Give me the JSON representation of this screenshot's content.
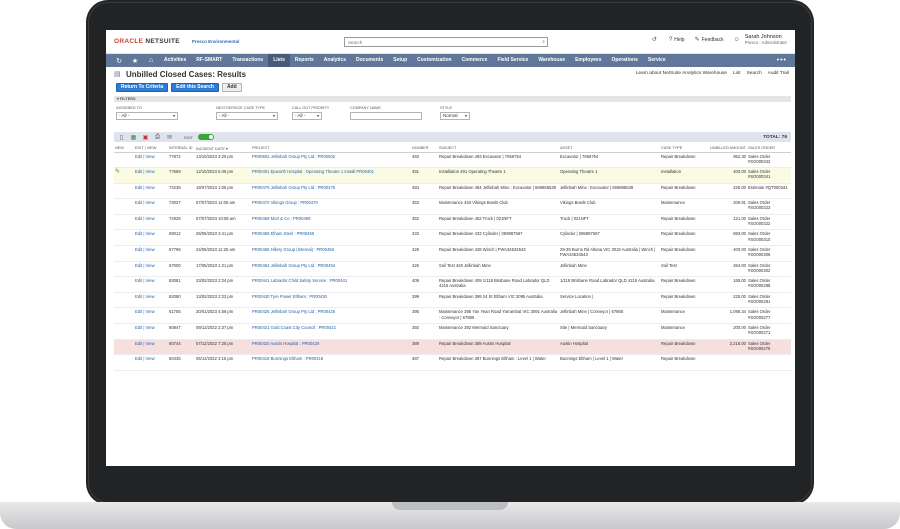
{
  "brand": {
    "oracle": "ORACLE",
    "netsuite": "NETSUITE",
    "partner": "Presco Environmental"
  },
  "search": {
    "placeholder": "Search"
  },
  "header": {
    "help": "Help",
    "feedback": "Feedback",
    "user_name": "Sarah Johnson",
    "user_role": "Presco - Administrator"
  },
  "nav": {
    "items": [
      "Activities",
      "RF-SMART",
      "Transactions",
      "Lists",
      "Reports",
      "Analytics",
      "Documents",
      "Setup",
      "Customization",
      "Commerce",
      "Field Service",
      "Warehouse",
      "Employees",
      "Operations",
      "Service"
    ],
    "active": "Lists",
    "more": "•••"
  },
  "page": {
    "title": "Unbilled Closed Cases: Results",
    "links": [
      "Learn about NetSuite Analytics Warehouse",
      "List",
      "Search",
      "Audit Trail"
    ]
  },
  "buttons": {
    "return": "Return To Criteria",
    "edit_search": "Edit this Search",
    "add": "Add"
  },
  "filters": {
    "bar_label": "FILTERS",
    "assigned_to": {
      "label": "ASSIGNED TO",
      "value": "- All -"
    },
    "case_type": {
      "label": "NEXTSERVICE CASE TYPE",
      "value": "- All -"
    },
    "priority": {
      "label": "CALL OUT PRIORITY",
      "value": "- All -"
    },
    "company": {
      "label": "COMPANY NAME",
      "value": ""
    },
    "style": {
      "label": "STYLE",
      "value": "Normal"
    }
  },
  "toolbar": {
    "edit_label": "EDIT",
    "total": "TOTAL: 76"
  },
  "columns": [
    "NEW",
    "EDIT | VIEW",
    "INTERNAL ID",
    "INCIDENT DATE ▾",
    "PROJECT",
    "NUMBER",
    "SUBJECT",
    "ASSET",
    "CASE TYPE",
    "UNBILLED AMOUNT",
    "SALES ORDER"
  ],
  "rows": [
    {
      "ev": "Edit | View",
      "id": "77872",
      "date": "13/10/2023 3:29 pm",
      "project": "PR00502 Jellinbah Group Pty Ltd : PR00502",
      "number": "493",
      "subject": "Repair Breakdown 493 Excavator | 7656754",
      "asset": "Excavator | 7656754",
      "type": "Repair Breakdown",
      "amount": "952.30",
      "so": "Sales Order #SO000342",
      "hl": ""
    },
    {
      "ev": "Edit | View",
      "id": "77569",
      "date": "12/10/2023 5:49 pm",
      "project": "PR00401 Epworth Hospital : Operating Theatre 1 Install PR00401",
      "number": "491",
      "subject": "Installation 491 Operating Theatre 1",
      "asset": "Operating Theatre 1",
      "type": "Installation",
      "amount": "400.00",
      "so": "Sales Order #SO000341",
      "hl": "yellow"
    },
    {
      "ev": "Edit | View",
      "id": "74235",
      "date": "19/07/2023 1:05 pm",
      "project": "PR00475 Jellinbah Group Pty Ltd : PR00475",
      "number": "484",
      "subject": "Repair Breakdown 484 Jellinbah Mine : Excavator | 669865539",
      "asset": "Jellinbah Mine : Excavator | 669865539",
      "type": "Repair Breakdown",
      "amount": "425.00",
      "so": "Estimate #QT000344",
      "hl": ""
    },
    {
      "ev": "Edit | View",
      "id": "73027",
      "date": "07/07/2023 11:05 am",
      "project": "PR00470 Vikings Group : PR00470",
      "number": "453",
      "subject": "Maintenance 453 Vikings Bowls Club",
      "asset": "Vikings Bowls Club",
      "type": "Maintenance",
      "amount": "206.91",
      "so": "Sales Order #SO000323",
      "hl": ""
    },
    {
      "ev": "Edit | View",
      "id": "72926",
      "date": "07/07/2023 10:08 am",
      "project": "PR00469 Mort & Co : PR00469",
      "number": "452",
      "subject": "Repair Breakdown 452 Truck | 021NFT",
      "asset": "Truck | 021NFT",
      "type": "Repair Breakdown",
      "amount": "121.00",
      "so": "Sales Order #SO000322",
      "hl": ""
    },
    {
      "ev": "Edit | View",
      "id": "69012",
      "date": "26/05/2023 3:41 pm",
      "project": "PR00459 Elham Steel : PR00459",
      "number": "433",
      "subject": "Repair Breakdown 433 Cylinder | 089987567",
      "asset": "Cylinder | 089987567",
      "type": "Repair Breakdown",
      "amount": "693.00",
      "so": "Sales Order #SO000310",
      "hl": ""
    },
    {
      "ev": "Edit | View",
      "id": "67796",
      "date": "24/05/2023 11:25 am",
      "project": "PR00456 Hillery Group (Internal) : PR00456",
      "number": "428",
      "subject": "Repair Breakdown 428 Winch | FWA34534543",
      "asset": "29-39 Burns Rd Altona VIC 3018 Australia | Winch | FWA34534543",
      "type": "Repair Breakdown",
      "amount": "400.00",
      "so": "Sales Order #SO000305",
      "hl": ""
    },
    {
      "ev": "Edit | View",
      "id": "67000",
      "date": "17/05/2023 1:21 pm",
      "project": "PR00454 Jellinbah Group Pty Ltd : PR00454",
      "number": "426",
      "subject": "Soil Test 426 Jellinbah Mine",
      "asset": "Jellinbah Mine",
      "type": "Soil Test",
      "amount": "264.00",
      "so": "Sales Order #SO000302",
      "hl": ""
    },
    {
      "ev": "Edit | View",
      "id": "63081",
      "date": "23/02/2023 2:24 pm",
      "project": "PR00441 Labrador Child Safety Service : PR00441",
      "number": "409",
      "subject": "Repair Breakdown 409 1/118 Brisbane Road Labrador QLD 4215 Australia",
      "asset": "1/118 Brisbane Road Labrador QLD 4215 Australia",
      "type": "Repair Breakdown",
      "amount": "165.00",
      "so": "Sales Order #SO000288",
      "hl": ""
    },
    {
      "ev": "Edit | View",
      "id": "62080",
      "date": "13/02/2023 2:23 pm",
      "project": "PR00430 Tyre Power Eltham : PR00430",
      "number": "399",
      "subject": "Repair Breakdown 399 24 St Eltham VIC 3095 Australia",
      "asset": "Service Location |",
      "type": "Repair Breakdown",
      "amount": "225.00",
      "so": "Sales Order #SO000281",
      "hl": ""
    },
    {
      "ev": "Edit | View",
      "id": "61755",
      "date": "20/01/2023 4:59 pm",
      "project": "PR00425 Jellinbah Group Pty Ltd : PR00425",
      "number": "395",
      "subject": "Maintenance 395 Yan Yean Road Yarrambat VIC 3091 Australia : Conveyor | 67865",
      "asset": "Jellinbah Mine | Conveyor | 67865",
      "type": "Maintenance",
      "amount": "1,095.34",
      "so": "Sales Order #SO000277",
      "hl": ""
    },
    {
      "ev": "Edit | View",
      "id": "60847",
      "date": "09/12/2022 2:37 pm",
      "project": "PR00421 Gold Coast City Council : PR00421",
      "number": "392",
      "subject": "Maintenance 392 Mermaid Sanctuary",
      "asset": "Site | Mermaid Sanctuary",
      "type": "Maintenance",
      "amount": "200.00",
      "so": "Sales Order #SO000271",
      "hl": ""
    },
    {
      "ev": "Edit | View",
      "id": "60744",
      "date": "07/12/2022 7:25 pm",
      "project": "PR00420 Austin Hospital : PR00420",
      "number": "389",
      "subject": "Repair Breakdown 389 Austin Hospital",
      "asset": "Austin Hospital",
      "type": "Repair Breakdown",
      "amount": "2,216.00",
      "so": "Sales Order #SO000270",
      "hl": "red"
    },
    {
      "ev": "Edit | View",
      "id": "60435",
      "date": "05/12/2022 3:15 pm",
      "project": "PR00418 Bunnings Eltham : PR00418",
      "number": "387",
      "subject": "Repair Breakdown 387 Bunnings Eltham : Level 1 | Water",
      "asset": "Bunnings Eltham | Level 1 | Water",
      "type": "Repair Breakdown",
      "amount": "",
      "so": "",
      "hl": ""
    }
  ]
}
